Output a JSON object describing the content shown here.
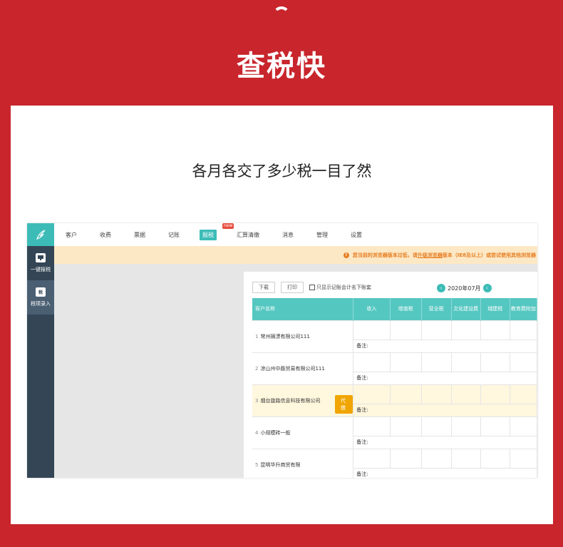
{
  "hero": {
    "title": "查税快",
    "subtitle": "各月各交了多少税一目了然"
  },
  "sidebar": {
    "items": [
      {
        "label": "一键报税",
        "icon": "monitor-icon"
      },
      {
        "label": "税项录入",
        "icon": "tax-entry-icon",
        "icon_text": "税"
      }
    ]
  },
  "nav": {
    "items": [
      "客户",
      "收费",
      "票据",
      "记账",
      "报税",
      "汇算清缴",
      "消息",
      "管理",
      "设置"
    ],
    "active": "报税",
    "badge": "new"
  },
  "notice": {
    "icon": "!",
    "text_before": "您当前的浏览器版本过低，请",
    "link": "升级浏览器",
    "text_after": "版本（IE8及以上）或尝试使用其他浏览器"
  },
  "toolbar": {
    "download": "下载",
    "print": "打印",
    "checkbox_label": "只显示记账会计名下账套",
    "period": "2020年07月",
    "prev": "‹",
    "next": "›"
  },
  "table": {
    "columns": [
      "客户名称",
      "收入",
      "增值税",
      "营业税",
      "文化建设费",
      "城建税",
      "教育费附加"
    ],
    "note_label": "备注:",
    "rows": [
      {
        "index": "1",
        "name": "常州摘漂有限公司111",
        "tag": ""
      },
      {
        "index": "2",
        "name": "凉山州中磊贸易有限公司111",
        "tag": ""
      },
      {
        "index": "3",
        "name": "烟台旋路信息科技有限公司",
        "tag": "代缴"
      },
      {
        "index": "4",
        "name": "小规模砖一般",
        "tag": ""
      },
      {
        "index": "5",
        "name": "昆明华升商贸有限",
        "tag": ""
      }
    ]
  }
}
